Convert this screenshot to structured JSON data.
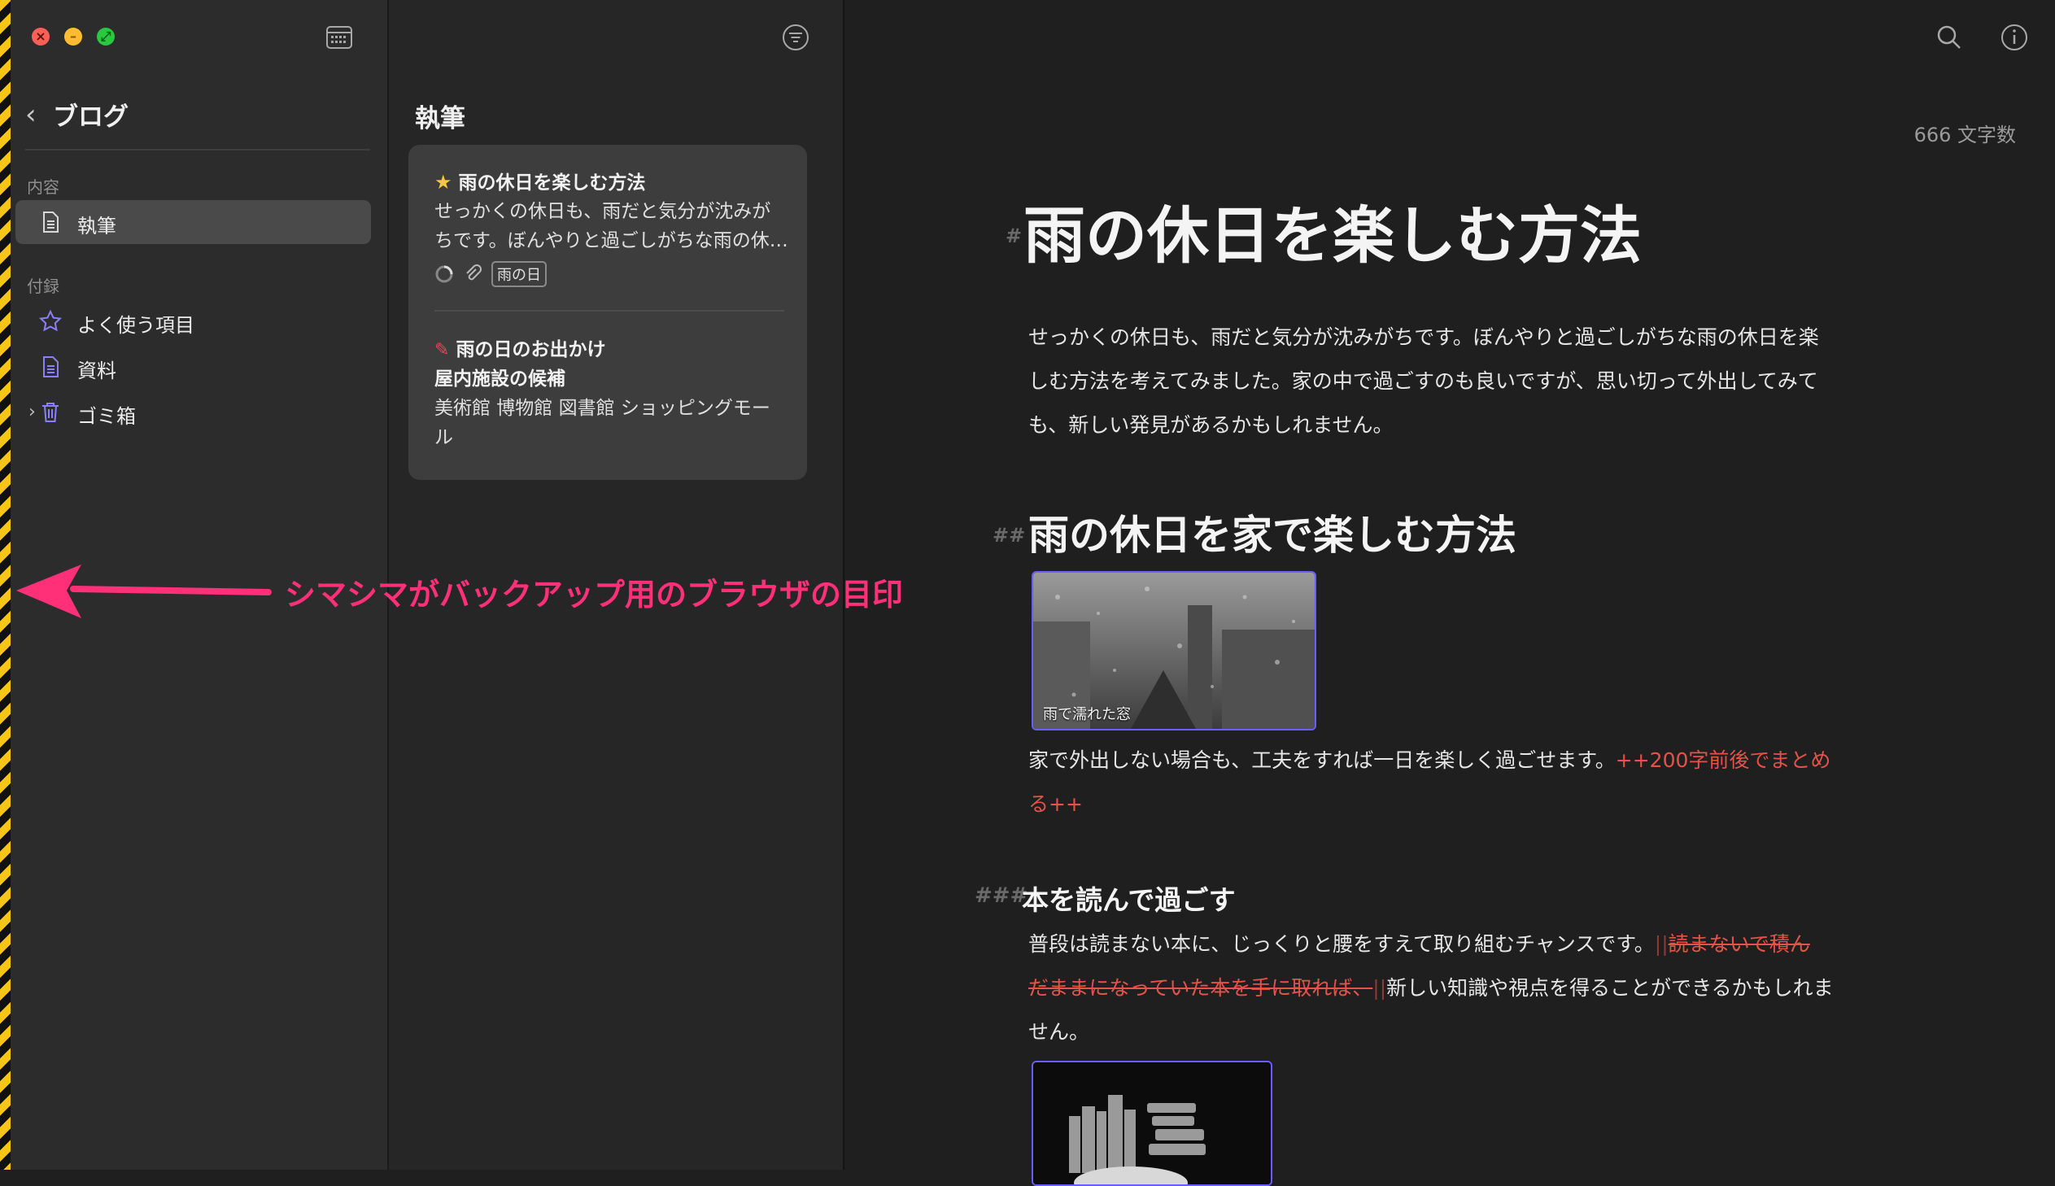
{
  "sidebar": {
    "title": "ブログ",
    "sections": [
      {
        "label": "内容",
        "items": [
          {
            "label": "執筆",
            "icon": "document-icon",
            "active": true
          }
        ]
      },
      {
        "label": "付録",
        "items": [
          {
            "label": "よく使う項目",
            "icon": "star-outline-icon"
          },
          {
            "label": "資料",
            "icon": "document-icon"
          },
          {
            "label": "ゴミ箱",
            "icon": "trash-icon"
          }
        ]
      }
    ]
  },
  "note_list": {
    "title": "執筆",
    "notes": [
      {
        "title": "雨の休日を楽しむ方法",
        "lines": [
          "せっかくの休日も、雨だと気分が沈みが",
          "ちです。ぼんやりと過ごしがちな雨の休…"
        ],
        "tag": "雨の日",
        "starred": true
      },
      {
        "title": "雨の日のお出かけ",
        "lines": [
          "屋内施設の候補",
          "美術館 博物館 図書館 ショッピングモー",
          "ル"
        ]
      }
    ]
  },
  "editor": {
    "word_count": "666 文字数",
    "h1_mark": "#",
    "h1": "雨の休日を楽しむ方法",
    "intro": [
      "せっかくの休日も、雨だと気分が沈みがちです。ぼんやりと過ごしがちな雨の休日を楽",
      "しむ方法を考えてみました。家の中で過ごすのも良いですが、思い切って外出してみて",
      "も、新しい発見があるかもしれません。"
    ],
    "h2_mark": "##",
    "h2": "雨の休日を家で楽しむ方法",
    "image1_caption": "雨で濡れた窓",
    "p2_text": "家で外出しない場合も、工夫をすれば一日を楽しく過ごせます。",
    "p2_ins_a": "++200字前後でまとめ",
    "p2_ins_b": "る++",
    "h3_mark": "###",
    "h3": "本を読んで過ごす",
    "p3_a": "普段は読まない本に、じっくりと腰をすえて取り組むチャンスです。",
    "p3_del_mark_open": "||",
    "p3_del_a": "読まないで積ん",
    "p3_del_b": "だままになっていた本を手に取れば、",
    "p3_del_mark_close": "||",
    "p3_b": "新しい知識や視点を得ることができるかもしれま",
    "p3_c": "せん。"
  },
  "annotation": "シマシマがバックアップ用のブラウザの目印",
  "colors": {
    "accent_pink": "#ff2f78",
    "stripe_yellow": "#f5c518",
    "track_changes_red": "#e4534a",
    "image_border": "#6b5cff"
  }
}
